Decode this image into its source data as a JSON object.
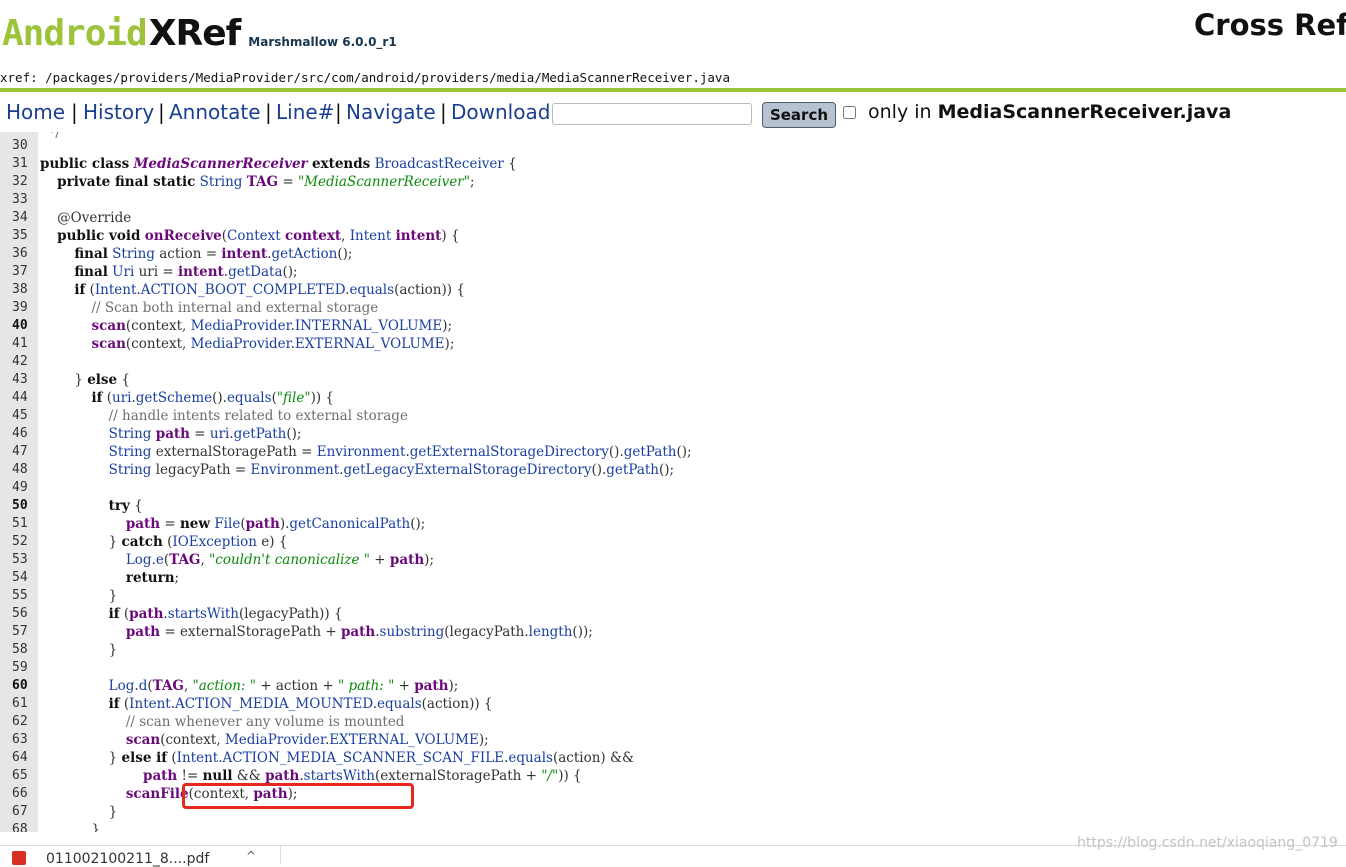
{
  "header": {
    "logo_android": "Android",
    "logo_xref": "XRef",
    "version": "Marshmallow 6.0.0_r1",
    "cross_ref": "Cross Refe",
    "xref_path": "xref: /packages/providers/MediaProvider/src/com/android/providers/media/MediaScannerReceiver.java",
    "accent_color": "#9dc33b"
  },
  "nav": {
    "links": [
      "Home",
      "History",
      "Annotate",
      "Line#",
      "Navigate",
      "Download"
    ],
    "separator": "|",
    "search_value": "",
    "search_button": "Search",
    "only_in_prefix": "only in ",
    "only_in_filename": "MediaScannerReceiver.java"
  },
  "code": {
    "line_numbers": [
      "30",
      "31",
      "32",
      "33",
      "34",
      "35",
      "36",
      "37",
      "38",
      "39",
      "40",
      "41",
      "42",
      "43",
      "44",
      "45",
      "46",
      "47",
      "48",
      "49",
      "50",
      "51",
      "52",
      "53",
      "54",
      "55",
      "56",
      "57",
      "58",
      "59",
      "60",
      "61",
      "62",
      "63",
      "64",
      "65",
      "66",
      "67",
      "68"
    ]
  },
  "download_bar": {
    "filename": "011002100211_8....pdf",
    "chevron": "^"
  },
  "watermark": "https://blog.csdn.net/xiaoqiang_0719",
  "highlight_color": "#e8281e"
}
